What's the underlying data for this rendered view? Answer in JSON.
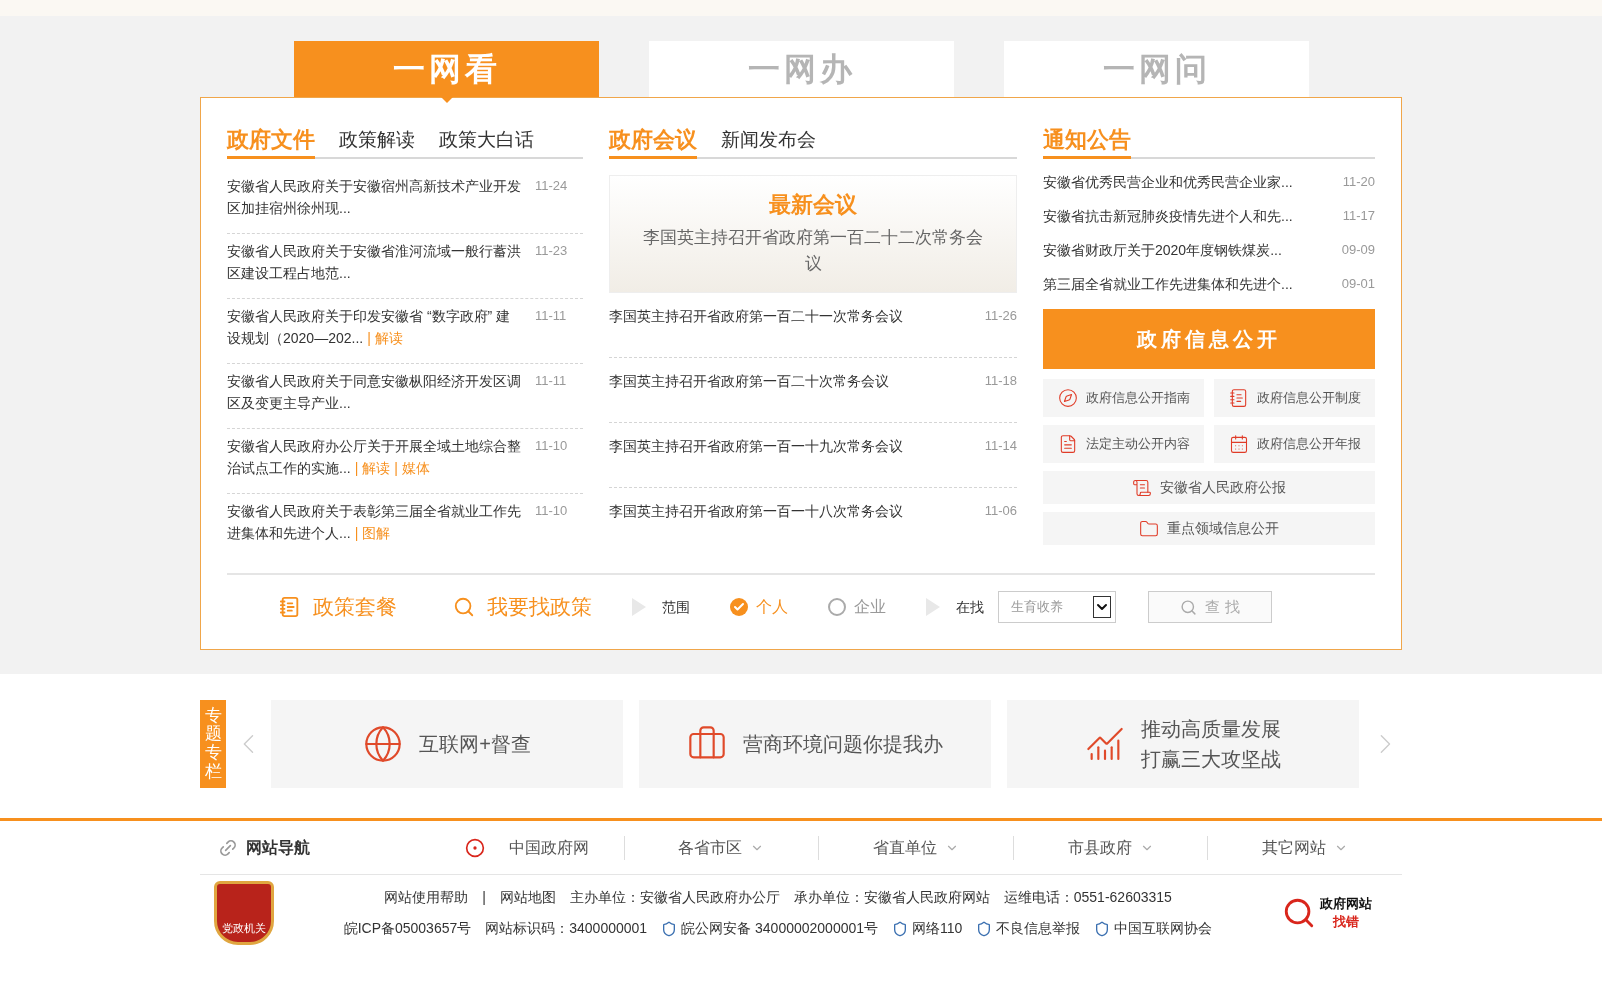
{
  "main_tabs": [
    {
      "label": "一网看",
      "selected": true
    },
    {
      "label": "一网办",
      "selected": false
    },
    {
      "label": "一网问",
      "selected": false
    }
  ],
  "documents": {
    "tabs": [
      {
        "label": "政府文件",
        "selected": true
      },
      {
        "label": "政策解读",
        "selected": false
      },
      {
        "label": "政策大白话",
        "selected": false
      }
    ],
    "items": [
      {
        "title": "安徽省人民政府关于安徽宿州高新技术产业开发区加挂宿州徐州现...",
        "date": "11-24"
      },
      {
        "title": "安徽省人民政府关于安徽省淮河流域一般行蓄洪区建设工程占地范...",
        "date": "11-23"
      },
      {
        "title": "安徽省人民政府关于印发安徽省 “数字政府” 建设规划（2020—202...",
        "date": "11-11",
        "links": [
          "| 解读"
        ]
      },
      {
        "title": "安徽省人民政府关于同意安徽枞阳经济开发区调区及变更主导产业...",
        "date": "11-11"
      },
      {
        "title": "安徽省人民政府办公厅关于开展全域土地综合整治试点工作的实施...",
        "date": "11-10",
        "links": [
          "| 解读",
          "| 媒体"
        ]
      },
      {
        "title": "安徽省人民政府关于表彰第三届全省就业工作先进集体和先进个人...",
        "date": "11-10",
        "links": [
          "| 图解"
        ]
      }
    ]
  },
  "meetings": {
    "tabs": [
      {
        "label": "政府会议",
        "selected": true
      },
      {
        "label": "新闻发布会",
        "selected": false
      }
    ],
    "featured": {
      "heading": "最新会议",
      "title": "李国英主持召开省政府第一百二十二次常务会议"
    },
    "items": [
      {
        "title": "李国英主持召开省政府第一百二十一次常务会议",
        "date": "11-26"
      },
      {
        "title": "李国英主持召开省政府第一百二十次常务会议",
        "date": "11-18"
      },
      {
        "title": "李国英主持召开省政府第一百一十九次常务会议",
        "date": "11-14"
      },
      {
        "title": "李国英主持召开省政府第一百一十八次常务会议",
        "date": "11-06"
      }
    ]
  },
  "notices": {
    "tabs": [
      {
        "label": "通知公告",
        "selected": true
      }
    ],
    "items": [
      {
        "title": "安徽省优秀民营企业和优秀民营企业家...",
        "date": "11-20"
      },
      {
        "title": "安徽省抗击新冠肺炎疫情先进个人和先...",
        "date": "11-17"
      },
      {
        "title": "安徽省财政厅关于2020年度钢铁煤炭...",
        "date": "09-09"
      },
      {
        "title": "第三届全省就业工作先进集体和先进个...",
        "date": "09-01"
      }
    ],
    "banner": "政府信息公开",
    "links": [
      {
        "label": "政府信息公开指南",
        "kind": "half"
      },
      {
        "label": "政府信息公开制度",
        "kind": "half"
      },
      {
        "label": "法定主动公开内容",
        "kind": "half"
      },
      {
        "label": "政府信息公开年报",
        "kind": "half"
      },
      {
        "label": "安徽省人民政府公报",
        "kind": "full"
      },
      {
        "label": "重点领域信息公开",
        "kind": "full"
      }
    ]
  },
  "policy_bar": {
    "package": "政策套餐",
    "finder": "我要找政策",
    "scope_label": "范围",
    "options": [
      {
        "label": "个人",
        "selected": true
      },
      {
        "label": "企业",
        "selected": false
      }
    ],
    "seek_label": "在找",
    "select_value": "生育收养",
    "search_button": "查 找"
  },
  "topics": {
    "label": "专题专栏",
    "items": [
      {
        "lines": [
          "互联网+督查"
        ]
      },
      {
        "lines": [
          "营商环境问题你提我办"
        ]
      },
      {
        "lines": [
          "推动高质量发展",
          "打赢三大攻坚战"
        ]
      }
    ]
  },
  "site_nav": {
    "label": "网站导航",
    "links": [
      {
        "label": "中国政府网",
        "has_menu": false
      },
      {
        "label": "各省市区",
        "has_menu": true
      },
      {
        "label": "省直单位",
        "has_menu": true
      },
      {
        "label": "市县政府",
        "has_menu": true
      },
      {
        "label": "其它网站",
        "has_menu": true
      }
    ]
  },
  "footer": {
    "badge": "党政机关",
    "row_1": [
      "网站使用帮助",
      "|",
      "网站地图",
      "主办单位：安徽省人民政府办公厅",
      "承办单位：安徽省人民政府网站",
      "运维电话：0551-62603315"
    ],
    "row_2": [
      {
        "label": "皖ICP备05003657号",
        "icon": false
      },
      {
        "label": "网站标识码：3400000001",
        "icon": false
      },
      {
        "label": "皖公网安备 34000002000001号",
        "icon": true
      },
      {
        "label": "网络110",
        "icon": true
      },
      {
        "label": "不良信息举报",
        "icon": true
      },
      {
        "label": "中国互联网协会",
        "icon": true
      }
    ],
    "error_logo": [
      "政府网站",
      "找错"
    ]
  }
}
